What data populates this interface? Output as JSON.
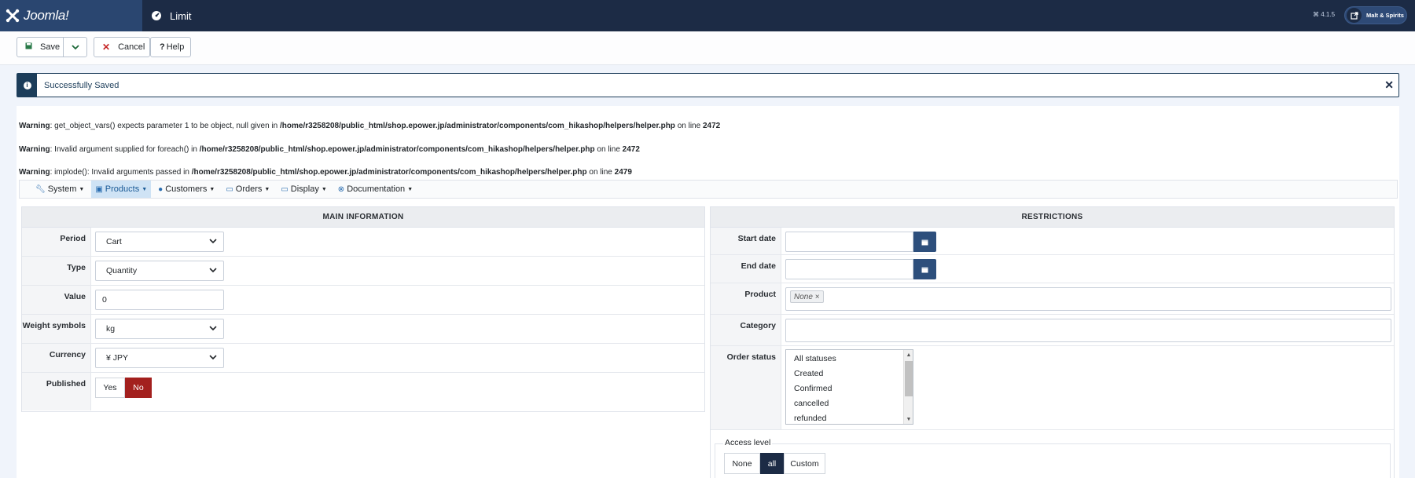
{
  "header": {
    "logo_text": "Joomla!",
    "page_title": "Limit",
    "version": "⌘ 4.1.5",
    "site_button": "Malt & Spirits"
  },
  "toolbar": {
    "save": "Save",
    "cancel": "Cancel",
    "help": "Help"
  },
  "alert": {
    "message": "Successfully Saved"
  },
  "warnings": [
    {
      "label": "Warning",
      "msg": ": get_object_vars() expects parameter 1 to be object, null given in ",
      "path": "/home/r3258208/public_html/shop.epower.jp/administrator/components/com_hikashop/helpers/helper.php",
      "online": " on line ",
      "line": "2472"
    },
    {
      "label": "Warning",
      "msg": ": Invalid argument supplied for foreach() in ",
      "path": "/home/r3258208/public_html/shop.epower.jp/administrator/components/com_hikashop/helpers/helper.php",
      "online": " on line ",
      "line": "2472"
    },
    {
      "label": "Warning",
      "msg": ": implode(): Invalid arguments passed in ",
      "path": "/home/r3258208/public_html/shop.epower.jp/administrator/components/com_hikashop/helpers/helper.php",
      "online": " on line ",
      "line": "2479"
    }
  ],
  "menu": [
    {
      "label": "System",
      "icon": "wrench-icon"
    },
    {
      "label": "Products",
      "icon": "cubes-icon"
    },
    {
      "label": "Customers",
      "icon": "user-icon"
    },
    {
      "label": "Orders",
      "icon": "credit-card-icon"
    },
    {
      "label": "Display",
      "icon": "monitor-icon"
    },
    {
      "label": "Documentation",
      "icon": "lifebuoy-icon"
    }
  ],
  "main": {
    "title": "MAIN INFORMATION",
    "period_label": "Period",
    "period_value": "Cart",
    "type_label": "Type",
    "type_value": "Quantity",
    "value_label": "Value",
    "value_value": "0",
    "weight_label": "Weight symbols",
    "weight_value": "kg",
    "currency_label": "Currency",
    "currency_value": "¥ JPY",
    "published_label": "Published",
    "yes": "Yes",
    "no": "No"
  },
  "restrictions": {
    "title": "RESTRICTIONS",
    "start_label": "Start date",
    "end_label": "End date",
    "product_label": "Product",
    "product_tag": "None",
    "product_tag_remove": "×",
    "category_label": "Category",
    "order_status_label": "Order status",
    "statuses": [
      "All statuses",
      "Created",
      "Confirmed",
      "cancelled",
      "refunded"
    ],
    "access_label": "Access level",
    "access_options": [
      "None",
      "all",
      "Custom"
    ]
  },
  "colors": {
    "header_bg": "#1c2b45",
    "accent": "#2d4f7c",
    "no_active": "#a3201e",
    "all_active": "#1c2b45"
  }
}
